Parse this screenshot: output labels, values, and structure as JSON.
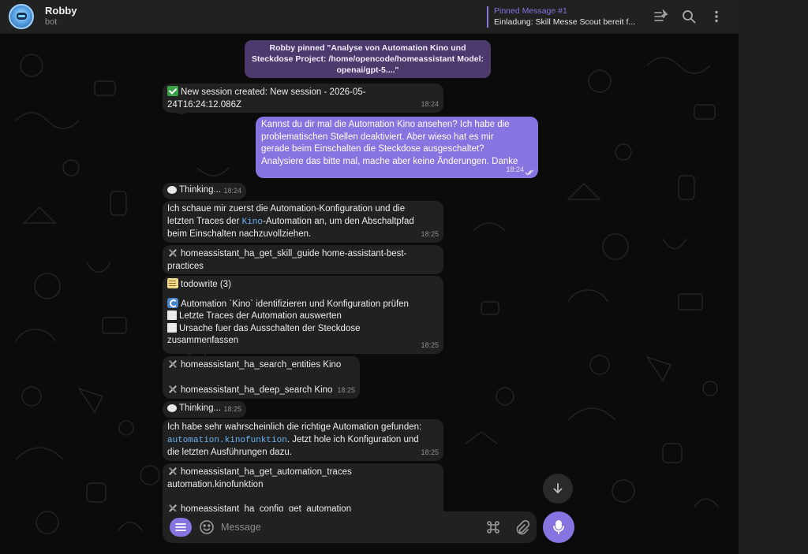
{
  "header": {
    "title": "Robby",
    "subtitle": "bot",
    "pinned_title": "Pinned Message #1",
    "pinned_text": "Einladung: Skill Messe Scout bereit f..."
  },
  "messages": {
    "pinned_notice": {
      "line1": "Robby pinned \"Analyse von Automation Kino und Steckdose",
      "line2": "Project: /home/opencode/homeassistant",
      "line3": "Model: openai/gpt-5....\""
    },
    "m1": {
      "line1": "New session created: New session - 2026-05-",
      "line2": "24T16:24:12.086Z",
      "time": "18:24"
    },
    "m2": {
      "lines": [
        "Kannst du dir mal die Automation Kino ansehen? Ich habe die",
        "problematischen Stellen deaktiviert. Aber wieso hat es mir",
        "gerade beim Einschalten die Steckdose ausgeschaltet?",
        "Analysiere das bitte mal, mache aber keine Änderungen. Danke"
      ],
      "time": "18:24"
    },
    "m3": {
      "text": "Thinking...",
      "time": "18:24"
    },
    "m4": {
      "line1": "Ich schaue mir zuerst die Automation-Konfiguration und die",
      "line2_pre": "letzten Traces der ",
      "line2_code": "Kino",
      "line2_post": "-Automation an, um den Abschaltpfad",
      "line3": "beim Einschalten nachzuvollziehen.",
      "time": "18:25"
    },
    "m5": {
      "line1": "homeassistant_ha_get_skill_guide home-assistant-best-",
      "line2": "practices"
    },
    "m6": {
      "title": "todowrite (3)",
      "item1": "Automation `Kino` identifizieren und Konfiguration prüfen",
      "item2": "Letzte Traces der Automation auswerten",
      "item3a": "Ursache fuer das Ausschalten der Steckdose",
      "item3b": "zusammenfassen",
      "time": "18:25"
    },
    "m7": {
      "text": "homeassistant_ha_search_entities Kino"
    },
    "m8": {
      "text": "homeassistant_ha_deep_search Kino",
      "time": "18:25"
    },
    "m9": {
      "text": "Thinking...",
      "time": "18:25"
    },
    "m10": {
      "line1": "Ich habe sehr wahrscheinlich die richtige Automation gefunden:",
      "line2_code": "automation.kinofunktion",
      "line2_post": ". Jetzt hole ich Konfiguration und",
      "line3": "die letzten Ausführungen dazu.",
      "time": "18:25"
    },
    "m11": {
      "line1": "homeassistant_ha_get_automation_traces",
      "line2": "automation.kinofunktion"
    },
    "m12": {
      "text": "homeassistant_ha_config_get_automation"
    }
  },
  "composer": {
    "placeholder": "Message"
  },
  "colors": {
    "accent": "#8774e1",
    "bubble_in": "#212121",
    "code": "#6ab2f2",
    "background": "#0b0b0c"
  },
  "icons": {
    "header": [
      "pinned-list-icon",
      "search-icon",
      "more-vertical-icon"
    ],
    "composer": [
      "menu-icon",
      "emoji-icon",
      "command-icon",
      "paperclip-icon",
      "microphone-icon"
    ],
    "scroll": "arrow-down-icon"
  }
}
